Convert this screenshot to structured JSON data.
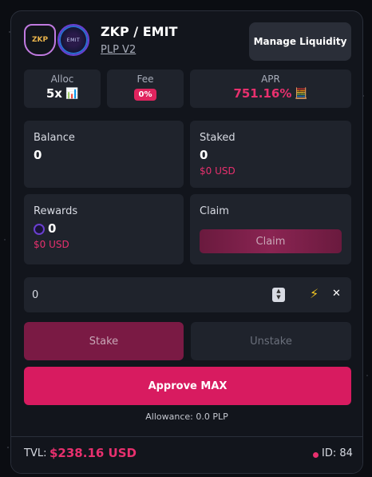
{
  "header": {
    "token_a_logo": "ZKP",
    "token_b_logo": "EMIT",
    "pair": "ZKP / EMIT",
    "pool_type": "PLP V2",
    "manage_label": "Manage Liquidity"
  },
  "stats": {
    "alloc_label": "Alloc",
    "alloc_value": "5x",
    "alloc_icon": "bar-chart-icon",
    "fee_label": "Fee",
    "fee_value": "0%",
    "apr_label": "APR",
    "apr_value": "751.16%",
    "apr_icon": "calculator-icon"
  },
  "balance": {
    "label": "Balance",
    "value": "0"
  },
  "staked": {
    "label": "Staked",
    "value": "0",
    "usd": "$0 USD"
  },
  "rewards": {
    "label": "Rewards",
    "value": "0",
    "usd": "$0 USD"
  },
  "claim": {
    "label": "Claim",
    "button": "Claim"
  },
  "amount": {
    "value": "0"
  },
  "actions": {
    "stake": "Stake",
    "unstake": "Unstake",
    "approve": "Approve MAX",
    "allowance": "Allowance: 0.0 PLP"
  },
  "footer": {
    "tvl_label": "TVL:",
    "tvl_value": "$238.16 USD",
    "id_text": "ID: 84"
  },
  "colors": {
    "accent": "#d81b60",
    "accent_text": "#e8306e",
    "tile": "#1f232c",
    "card": "#12151c"
  }
}
